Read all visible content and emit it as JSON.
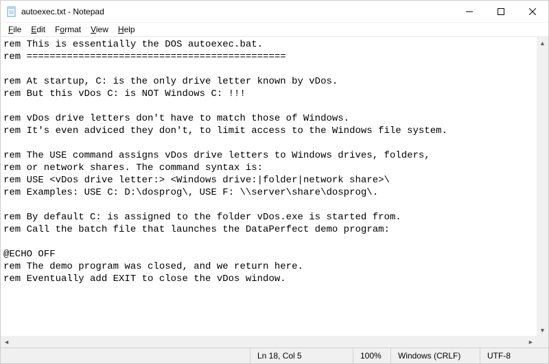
{
  "titlebar": {
    "title": "autoexec.txt - Notepad"
  },
  "menubar": {
    "file": "File",
    "edit": "Edit",
    "format": "Format",
    "view": "View",
    "help": "Help"
  },
  "editor": {
    "content": "rem This is essentially the DOS autoexec.bat.\nrem =============================================\n\nrem At startup, C: is the only drive letter known by vDos.\nrem But this vDos C: is NOT Windows C: !!!\n\nrem vDos drive letters don't have to match those of Windows.\nrem It's even adviced they don't, to limit access to the Windows file system.\n\nrem The USE command assigns vDos drive letters to Windows drives, folders,\nrem or network shares. The command syntax is:\nrem USE <vDos drive letter:> <Windows drive:|folder|network share>\\\nrem Examples: USE C: D:\\dosprog\\, USE F: \\\\server\\share\\dosprog\\.\n\nrem By default C: is assigned to the folder vDos.exe is started from.\nrem Call the batch file that launches the DataPerfect demo program:\n\n@ECHO OFF\nrem The demo program was closed, and we return here.\nrem Eventually add EXIT to close the vDos window."
  },
  "statusbar": {
    "position": "Ln 18, Col 5",
    "zoom": "100%",
    "line_ending": "Windows (CRLF)",
    "encoding": "UTF-8"
  }
}
